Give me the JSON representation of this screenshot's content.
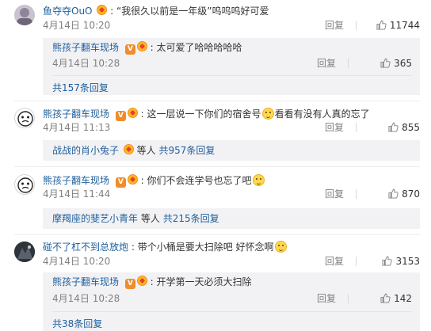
{
  "like_icon": "thumbs-up-icon",
  "colors": {
    "username": "#1e5f9c",
    "meta": "#808080",
    "sub_bg": "#f2f2f5"
  },
  "comments": [
    {
      "user": "鱼夺夺OuO",
      "sep": ":",
      "text": "“我很久以前是一年级”呜呜呜好可爱",
      "date": "4月14日 10:20",
      "reply": "回复",
      "likes": "11744",
      "sub": {
        "user": "熊孩子翻车现场",
        "sep": ":",
        "text": "太可爱了哈哈哈哈哈",
        "date": "4月14日 10:28",
        "reply": "回复",
        "likes": "365",
        "total": "共157条回复"
      }
    },
    {
      "user": "熊孩子翻车现场",
      "sep": ":",
      "text_a": "这一层说一下你们的宿舍号",
      "text_b": "看看有没有人真的忘了",
      "date": "4月14日 11:13",
      "reply": "回复",
      "likes": "855",
      "replies": {
        "user": "战战的肖小兔子",
        "mid": "等人",
        "count": "共957条回复"
      }
    },
    {
      "user": "熊孩子翻车现场",
      "sep": ":",
      "text": "你们不会连学号也忘了吧",
      "date": "4月14日 11:44",
      "reply": "回复",
      "likes": "870",
      "replies": {
        "user": "摩羯座的斐艺小青年",
        "mid": "等人",
        "count": "共215条回复"
      }
    },
    {
      "user": "碰不了杠不到总放炮",
      "sep": ":",
      "text": "带个小桶是要大扫除吧 好怀念啊",
      "date": "4月14日 10:20",
      "reply": "回复",
      "likes": "3153",
      "sub": {
        "user": "熊孩子翻车现场",
        "sep": ":",
        "text": "开学第一天必须大扫除",
        "date": "4月14日 10:28",
        "reply": "回复",
        "likes": "142",
        "total": "共38条回复"
      }
    }
  ]
}
